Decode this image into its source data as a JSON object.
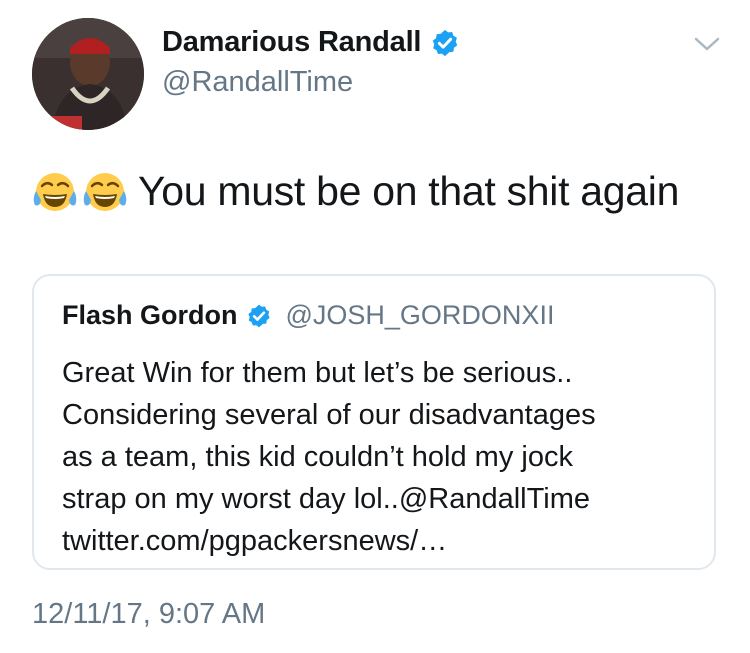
{
  "author": {
    "display_name": "Damarious Randall",
    "handle": "@RandallTime"
  },
  "tweet": {
    "emojis": [
      "face-with-tears-of-joy",
      "face-with-tears-of-joy"
    ],
    "text": "You must be on that shit again"
  },
  "quoted_tweet": {
    "display_name": "Flash Gordon",
    "handle": "@JOSH_GORDONXII",
    "lines": [
      "Great Win for them but let’s be serious..",
      "Considering several of our disadvantages",
      "as a team, this kid couldn’t hold my jock",
      "strap on my worst day lol..@RandallTime",
      "twitter.com/pgpackersnews/…"
    ]
  },
  "timestamp": "12/11/17, 9:07 AM",
  "colors": {
    "verified_blue": "#1da1f2",
    "secondary_text": "#657786",
    "border": "#e1e8ed"
  }
}
